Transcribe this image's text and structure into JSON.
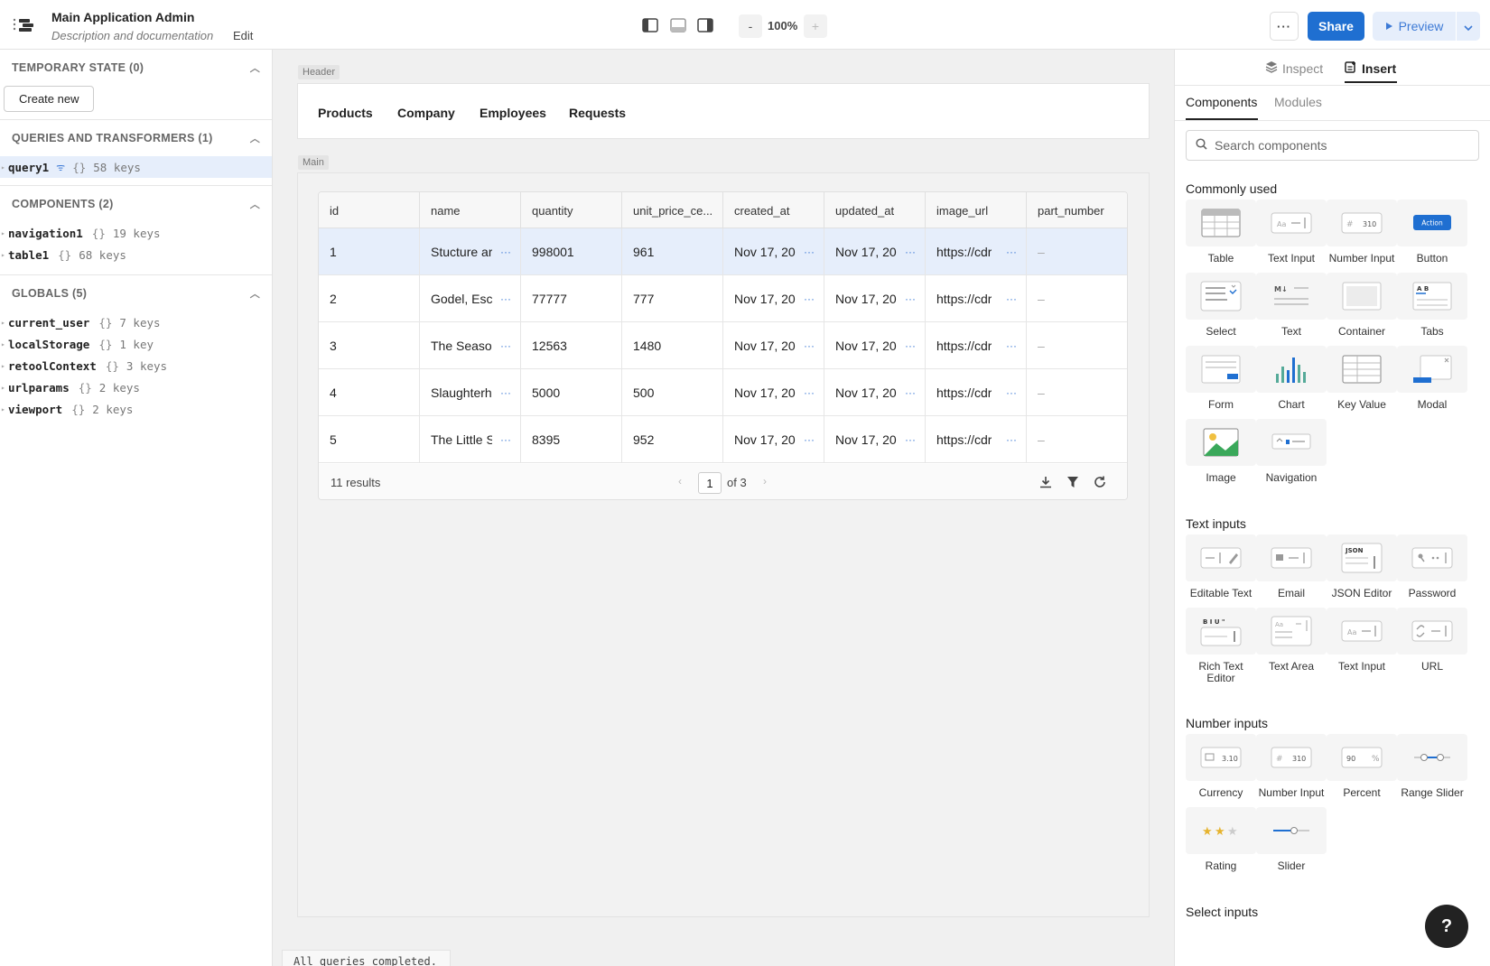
{
  "app": {
    "title": "Main Application Admin",
    "description": "Description and documentation",
    "edit_label": "Edit"
  },
  "toolbar": {
    "zoom_minus": "-",
    "zoom_value": "100%",
    "zoom_plus": "+",
    "more_label": "···",
    "share_label": "Share",
    "preview_label": "Preview"
  },
  "left_panel": {
    "temporary_state": {
      "title": "TEMPORARY STATE (0)",
      "create_button": "Create new"
    },
    "queries": {
      "title": "QUERIES AND TRANSFORMERS (1)",
      "items": [
        {
          "name": "query1",
          "braces": "{}",
          "keys": "58 keys"
        }
      ]
    },
    "components": {
      "title": "COMPONENTS (2)",
      "items": [
        {
          "name": "navigation1",
          "braces": "{}",
          "keys": "19 keys"
        },
        {
          "name": "table1",
          "braces": "{}",
          "keys": "68 keys"
        }
      ]
    },
    "globals": {
      "title": "GLOBALS (5)",
      "items": [
        {
          "name": "current_user",
          "braces": "{}",
          "keys": "7 keys"
        },
        {
          "name": "localStorage",
          "braces": "{}",
          "keys": "1 key"
        },
        {
          "name": "retoolContext",
          "braces": "{}",
          "keys": "3 keys"
        },
        {
          "name": "urlparams",
          "braces": "{}",
          "keys": "2 keys"
        },
        {
          "name": "viewport",
          "braces": "{}",
          "keys": "2 keys"
        }
      ]
    }
  },
  "canvas": {
    "header_tag": "Header",
    "main_tag": "Main",
    "nav": [
      "Products",
      "Company",
      "Employees",
      "Requests"
    ],
    "table": {
      "columns": [
        "id",
        "name",
        "quantity",
        "unit_price_ce...",
        "created_at",
        "updated_at",
        "image_url",
        "part_number"
      ],
      "rows": [
        [
          "1",
          "Stucture ar",
          "998001",
          "961",
          "Nov 17, 20",
          "Nov 17, 20",
          "https://cdr",
          "–"
        ],
        [
          "2",
          "Godel, Esc",
          "77777",
          "777",
          "Nov 17, 20",
          "Nov 17, 20",
          "https://cdr",
          "–"
        ],
        [
          "3",
          "The Seaso",
          "12563",
          "1480",
          "Nov 17, 20",
          "Nov 17, 20",
          "https://cdr",
          "–"
        ],
        [
          "4",
          "Slaughterh",
          "5000",
          "500",
          "Nov 17, 20",
          "Nov 17, 20",
          "https://cdr",
          "–"
        ],
        [
          "5",
          "The Little S",
          "8395",
          "952",
          "Nov 17, 20",
          "Nov 17, 20",
          "https://cdr",
          "–"
        ]
      ],
      "results": "11 results",
      "page": "1",
      "page_of": "of 3"
    },
    "status": "All queries completed."
  },
  "right_panel": {
    "tabs": [
      "Inspect",
      "Insert"
    ],
    "subtabs": [
      "Components",
      "Modules"
    ],
    "search_placeholder": "Search components",
    "sections": [
      {
        "title": "Commonly used",
        "items": [
          "Table",
          "Text Input",
          "Number Input",
          "Button",
          "Select",
          "Text",
          "Container",
          "Tabs",
          "Form",
          "Chart",
          "Key Value",
          "Modal",
          "Image",
          "Navigation"
        ]
      },
      {
        "title": "Text inputs",
        "items": [
          "Editable Text",
          "Email",
          "JSON Editor",
          "Password",
          "Rich Text Editor",
          "Text Area",
          "Text Input",
          "URL"
        ]
      },
      {
        "title": "Number inputs",
        "items": [
          "Currency",
          "Number Input",
          "Percent",
          "Range Slider",
          "Rating",
          "Slider"
        ]
      },
      {
        "title": "Select inputs",
        "items": []
      }
    ],
    "tile_text": {
      "number": "310",
      "action": "Action",
      "tabs": "A B",
      "json": "JSON",
      "currency": "3.10",
      "percent": "90",
      "richtext": "B I U \"",
      "aa": "Aa",
      "md": "M↓"
    },
    "help": "?"
  },
  "colors": {
    "accent": "#1f6fd1",
    "selected_row": "#e6eefb"
  }
}
